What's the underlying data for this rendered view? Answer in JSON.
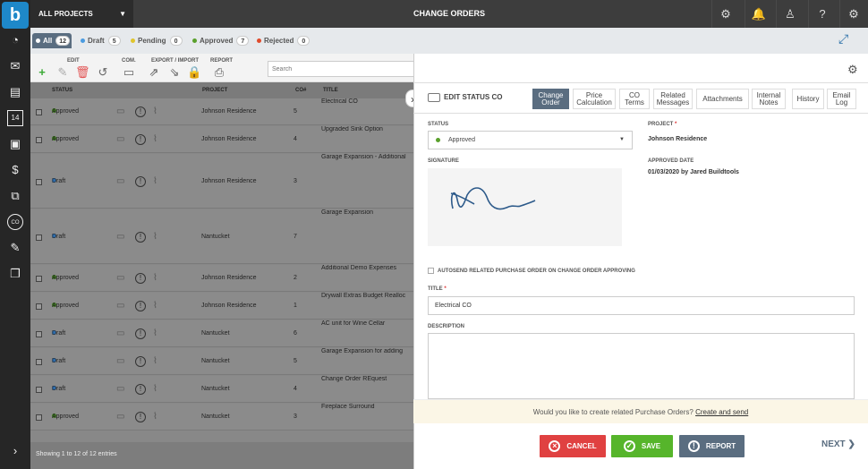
{
  "app": {
    "logo": "b"
  },
  "topbar": {
    "project_selector": "ALL PROJECTS",
    "title": "CHANGE ORDERS",
    "icons": [
      "android-icon",
      "bell-icon",
      "user-icon",
      "help-icon",
      "gear-icon"
    ]
  },
  "sidebar": {
    "icons": [
      "dashboard-icon",
      "mail-icon",
      "clipboard-icon",
      "calendar-icon",
      "briefcase-icon",
      "dollar-icon",
      "structure-icon",
      "co-icon",
      "tools-icon",
      "layers-icon"
    ],
    "calendar_day": "14",
    "co_badge": "CO",
    "expand": "›"
  },
  "filters": [
    {
      "label": "All",
      "count": "12",
      "color": "#ffffff",
      "active": true
    },
    {
      "label": "Draft",
      "count": "5",
      "color": "#4a9be0"
    },
    {
      "label": "Pending",
      "count": "0",
      "color": "#e0c52c"
    },
    {
      "label": "Approved",
      "count": "7",
      "color": "#5aa02c"
    },
    {
      "label": "Rejected",
      "count": "0",
      "color": "#e04b2c"
    }
  ],
  "toolbar": {
    "edit_label": "EDIT",
    "com_label": "COM.",
    "export_label": "EXPORT / IMPORT",
    "report_label": "REPORT",
    "search_placeholder": "Search"
  },
  "grid": {
    "headers": {
      "status": "STATUS",
      "project": "PROJECT",
      "co": "CO#",
      "title": "TITLE"
    },
    "rows": [
      {
        "status": "Approved",
        "project": "Johnson Residence",
        "co": "5",
        "title": "Electrical CO"
      },
      {
        "status": "Approved",
        "project": "Johnson Residence",
        "co": "4",
        "title": "Upgraded Sink Option"
      },
      {
        "status": "Draft",
        "project": "Johnson Residence",
        "co": "3",
        "title": "Garage Expansion - Additional"
      },
      {
        "status": "Draft",
        "project": "Nantucket",
        "co": "7",
        "title": "Garage Expansion"
      },
      {
        "status": "Approved",
        "project": "Johnson Residence",
        "co": "2",
        "title": "Additional Demo Expenses"
      },
      {
        "status": "Approved",
        "project": "Johnson Residence",
        "co": "1",
        "title": "Drywall Extras Budget Realloc"
      },
      {
        "status": "Draft",
        "project": "Nantucket",
        "co": "6",
        "title": "AC unit for Wine Cellar"
      },
      {
        "status": "Draft",
        "project": "Nantucket",
        "co": "5",
        "title": "Garage Expansion for adding"
      },
      {
        "status": "Draft",
        "project": "Nantucket",
        "co": "4",
        "title": "Change Order REquest"
      },
      {
        "status": "Approved",
        "project": "Nantucket",
        "co": "3",
        "title": "Fireplace Surround"
      }
    ],
    "status_colors": {
      "Approved": "#3d7a1e",
      "Draft": "#2f6fb0"
    },
    "footer": "Showing 1 to 12 of 12 entries"
  },
  "panel": {
    "edit_title": "EDIT STATUS CO",
    "tabs": [
      {
        "line1": "Change",
        "line2": "Order",
        "active": true
      },
      {
        "line1": "Price",
        "line2": "Calculation"
      },
      {
        "line1": "CO",
        "line2": "Terms"
      },
      {
        "line1": "Related",
        "line2": "Messages"
      },
      {
        "line1": "Attachments",
        "line2": ""
      },
      {
        "line1": "Internal",
        "line2": "Notes"
      },
      {
        "line1": "History",
        "line2": ""
      },
      {
        "line1": "Email",
        "line2": "Log"
      }
    ],
    "status_label": "STATUS",
    "status_value": "Approved",
    "project_label": "PROJECT",
    "project_value": "Johnson Residence",
    "signature_label": "SIGNATURE",
    "approved_date_label": "APPROVED DATE",
    "approved_date_value": "01/03/2020 by Jared Buildtools",
    "autosend_label": "AUTOSEND RELATED PURCHASE ORDER ON CHANGE ORDER APPROVING",
    "title_label": "TITLE",
    "title_value": "Electrical CO",
    "description_label": "DESCRIPTION",
    "notice_text": "Would you like to create related Purchase Orders?",
    "notice_link": "Create and send",
    "cancel": "CANCEL",
    "save": "SAVE",
    "report": "REPORT",
    "next": "NEXT"
  }
}
